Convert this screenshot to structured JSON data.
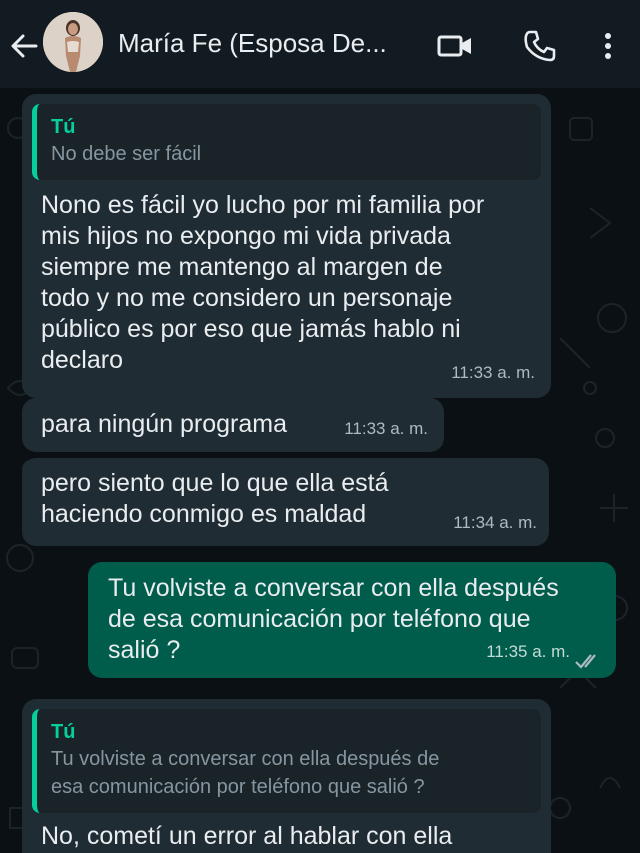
{
  "header": {
    "contact_name": "María Fe (Esposa De...",
    "icons": [
      "back-arrow-icon",
      "video-call-icon",
      "voice-call-icon",
      "more-options-icon"
    ]
  },
  "messages": [
    {
      "direction": "incoming",
      "quote_author": "Tú",
      "quote_text": "No debe ser fácil",
      "text": "Nono es fácil yo lucho por mi familia por\nmis hijos no expongo mi vida privada\nsiempre me mantengo al margen de\ntodo y no me considero un personaje\npúblico es por eso que jamás hablo ni\ndeclaro",
      "time": "11:33 a. m."
    },
    {
      "direction": "incoming",
      "text": "para ningún programa",
      "time": "11:33 a. m."
    },
    {
      "direction": "incoming",
      "text": "pero siento que lo que ella está\nhaciendo conmigo es maldad",
      "time": "11:34 a. m."
    },
    {
      "direction": "outgoing",
      "text": "Tu volviste a conversar con ella después\nde esa comunicación por teléfono que\nsalió ?",
      "time": "11:35 a. m.",
      "status": "read"
    },
    {
      "direction": "incoming",
      "quote_author": "Tú",
      "quote_text": "Tu volviste a conversar con ella después de\nesa comunicación por teléfono que salió ?",
      "text": "No, cometí un error al hablar con ella"
    }
  ],
  "colors": {
    "header_bg": "#121b22",
    "chat_bg": "#0b1014",
    "incoming_bubble": "#202c33",
    "outgoing_bubble": "#005c4b",
    "quote_accent": "#06cf9c",
    "read_tick": "#53bdeb"
  }
}
